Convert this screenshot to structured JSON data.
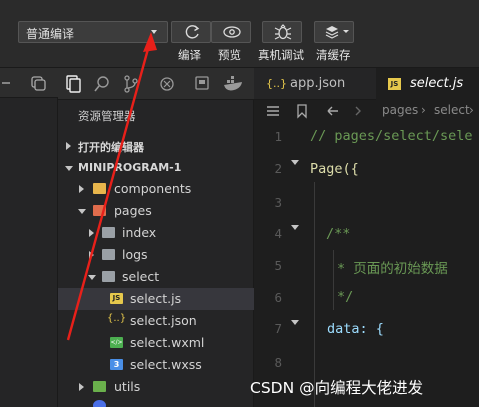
{
  "toolbar": {
    "compile_mode": "普通编译",
    "buttons": [
      {
        "label": "编译",
        "icon": "refresh-icon"
      },
      {
        "label": "预览",
        "icon": "eye-icon"
      },
      {
        "label": "真机调试",
        "icon": "bug-icon"
      },
      {
        "label": "清缓存",
        "icon": "layers-icon"
      }
    ]
  },
  "explorer": {
    "title": "资源管理器",
    "open_editors": "打开的编辑器",
    "project": "MINIPROGRAM-1",
    "tree": [
      {
        "label": "components",
        "type": "folder",
        "color": "#e8b64c"
      },
      {
        "label": "pages",
        "type": "folder",
        "color": "#e06c4c"
      },
      {
        "label": "index",
        "type": "folder",
        "color": "#9aa0a6"
      },
      {
        "label": "logs",
        "type": "folder",
        "color": "#9aa0a6"
      },
      {
        "label": "select",
        "type": "folder",
        "color": "#9aa0a6"
      },
      {
        "label": "select.js",
        "type": "js",
        "badge": "JS",
        "color": "#e6c84c"
      },
      {
        "label": "select.json",
        "type": "json",
        "badge": "{..}",
        "color": "#e6c84c"
      },
      {
        "label": "select.wxml",
        "type": "wxml",
        "badge": "</>",
        "color": "#4caf50"
      },
      {
        "label": "select.wxss",
        "type": "wxss",
        "badge": "3",
        "color": "#4a8fe7"
      },
      {
        "label": "utils",
        "type": "folder",
        "color": "#6ab04c"
      }
    ]
  },
  "editor": {
    "tabs": [
      {
        "label": "app.json",
        "badge": "{..}"
      },
      {
        "label": "select.js",
        "badge": "JS"
      }
    ],
    "breadcrumb": [
      "pages",
      "select"
    ],
    "line_numbers": [
      "1",
      "2",
      "3",
      "4",
      "5",
      "6",
      "7",
      "8"
    ],
    "lines": [
      "// pages/select/sele",
      "Page({",
      "/**",
      "* 页面的初始数据",
      "*/",
      "data: {"
    ]
  },
  "watermark": "CSDN @向编程大佬进发",
  "colors": {
    "comment": "#6a9955",
    "keyword_fn": "#dcdcaa",
    "bracket": "#da70d6",
    "property": "#9cdcfe",
    "arrow": "#e8201a"
  }
}
